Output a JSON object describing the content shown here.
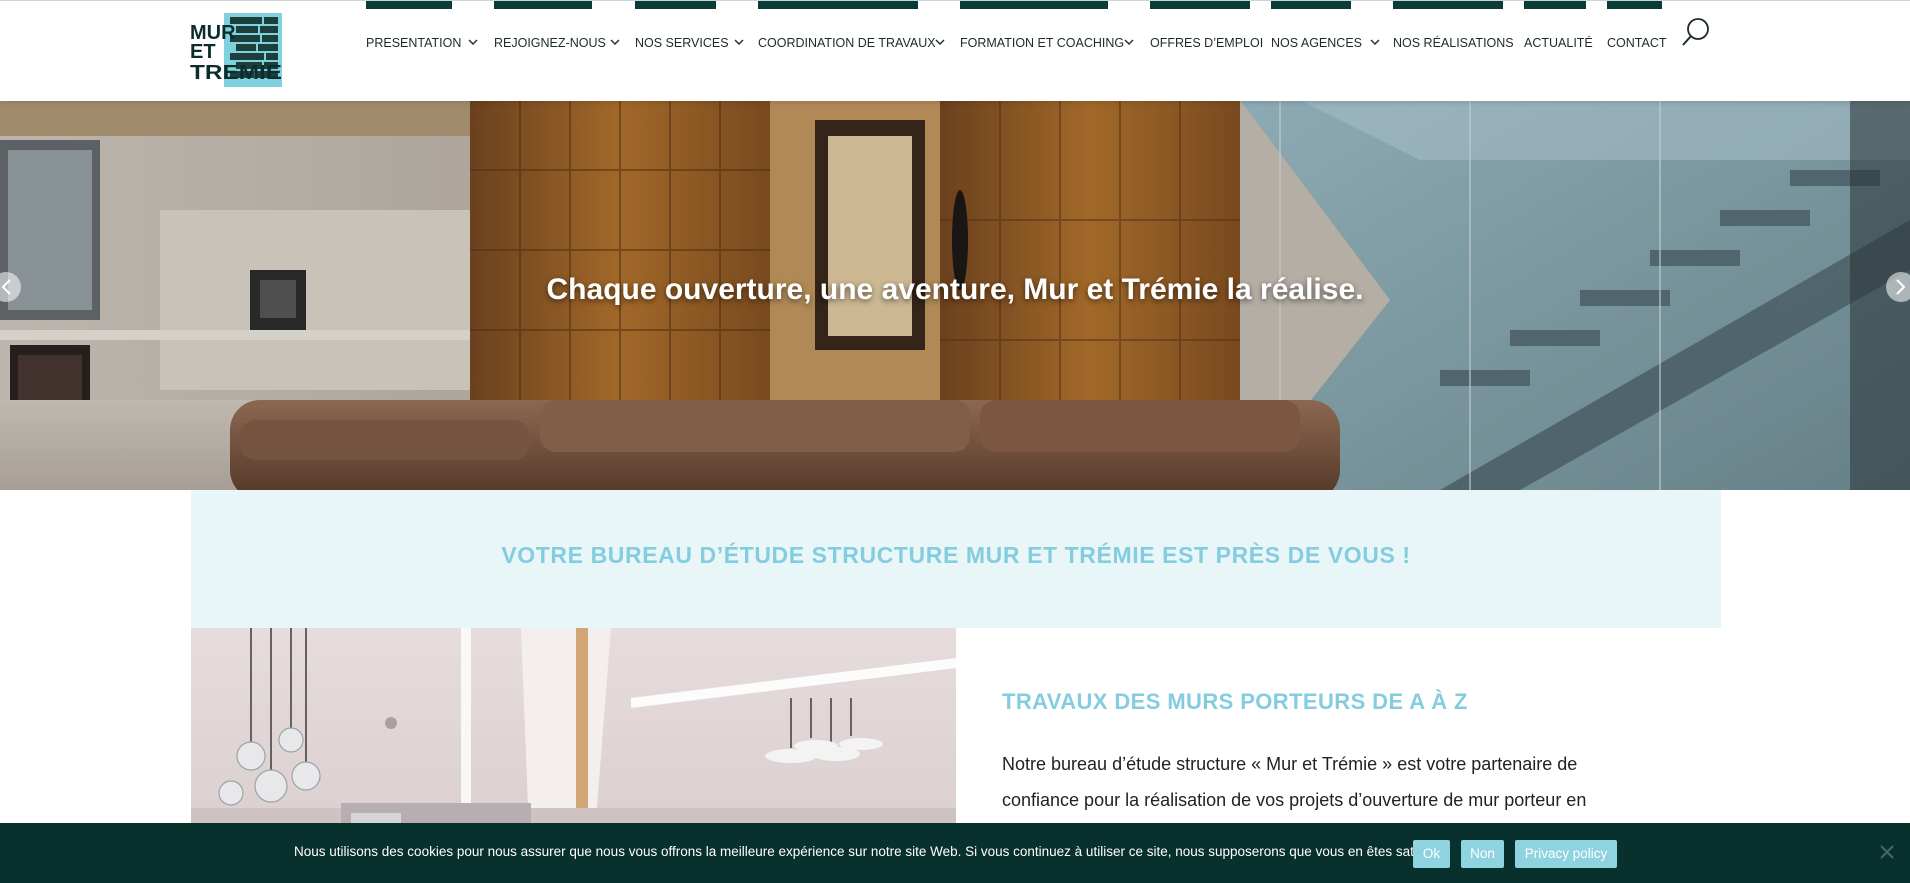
{
  "header": {
    "logo_alt": "MUR ET TREMIE",
    "logo_lines": [
      "MUR",
      "ET",
      "TREMIE"
    ],
    "nav": [
      {
        "label": "PRESENTATION",
        "has_dropdown": true
      },
      {
        "label": "REJOIGNEZ-NOUS",
        "has_dropdown": true
      },
      {
        "label": "NOS SERVICES",
        "has_dropdown": true
      },
      {
        "label": "COORDINATION DE TRAVAUX",
        "has_dropdown": true
      },
      {
        "label": "FORMATION ET COACHING",
        "has_dropdown": true
      },
      {
        "label": "OFFRES D’EMPLOI",
        "has_dropdown": false
      },
      {
        "label": "NOS AGENCES",
        "has_dropdown": true
      },
      {
        "label": "NOS RÉALISATIONS",
        "has_dropdown": false
      },
      {
        "label": "ACTUALITÉ",
        "has_dropdown": false
      },
      {
        "label": "CONTACT",
        "has_dropdown": false
      }
    ],
    "search_icon": "search-icon"
  },
  "hero": {
    "caption": "Chaque ouverture, une aventure, Mur et Trémie la réalise."
  },
  "banner": {
    "title": "VOTRE BUREAU D’ÉTUDE STRUCTURE MUR ET TRÉMIE EST PRÈS DE VOUS !"
  },
  "section": {
    "title": "TRAVAUX DES MURS PORTEURS DE A À Z",
    "body": "Notre bureau d’étude structure « Mur et Trémie » est votre partenaire de confiance pour la réalisation de vos projets d’ouverture de mur porteur en"
  },
  "cookie": {
    "text": "Nous utilisons des cookies pour nous assurer que nous vous offrons la meilleure expérience sur notre site Web. Si vous continuez à utiliser ce site, nous supposerons que vous en êtes satisfait.",
    "ok_label": "Ok",
    "no_label": "Non",
    "privacy_label": "Privacy policy"
  },
  "colors": {
    "brand_dark": "#0b3b38",
    "accent": "#84cde0",
    "banner_bg": "#e8f6f7",
    "cookie_bg": "#08302c"
  }
}
